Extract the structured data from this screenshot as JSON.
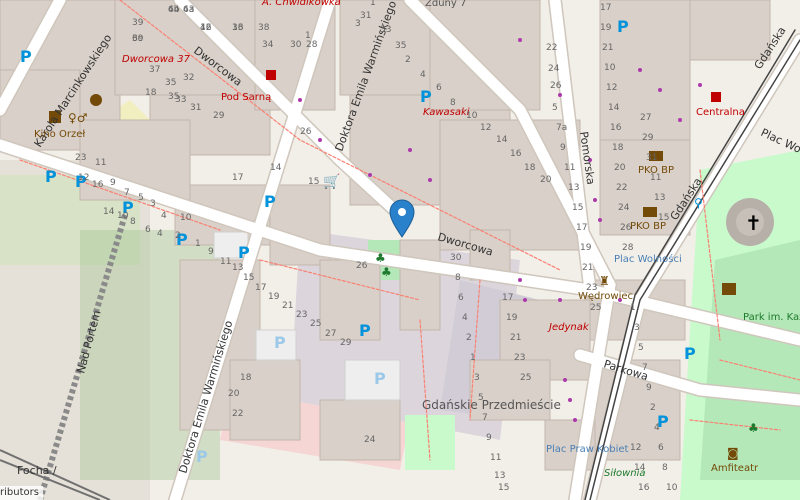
{
  "map": {
    "colors": {
      "background": "#f2efe9",
      "building": "#d9d0c9",
      "building_stroke": "#c4b6ab",
      "road": "#ffffff",
      "road_casing": "#cfc6bc",
      "pedestrian": "#dddde8",
      "park": "#c8facc",
      "green": "#add19e",
      "parking": "#eeeeee",
      "rail": "#707070",
      "footway": "#fa8072",
      "retail": "#ffd6d1",
      "tram": "#444444",
      "parking_icon": "#0092da",
      "label": "#333333",
      "poi_red": "#c00000",
      "poi_brown": "#734a08",
      "marker": "#2a81cb"
    },
    "street_labels": [
      "Karola Marcinkowskiego",
      "Dworcowa",
      "Doktora Emila Warmińskiego",
      "Dworcowa",
      "Nad Portem",
      "Doktora Emila Warmińskiego",
      "Pomorska",
      "Gdańska",
      "Parkowa",
      "Gdańska",
      "Plac Wolności",
      "Focha /"
    ],
    "place_labels": [
      "Gdańskie Przedmieście",
      "Plac Wolności",
      "Park im. Kazimierza Wielkiego",
      "Plac Praw Kobiet"
    ],
    "poi_labels": [
      "Kino Orzeł",
      "Pod Sarną",
      "Centralna",
      "PKO BP",
      "PKO BP",
      "Wędrowiec",
      "Jedynak",
      "Kawasaki",
      "Dworcowa 37",
      "A. Chwidikowka",
      "Siłownia",
      "Amfiteatr",
      "Zduny 7"
    ],
    "house_numbers": [
      "39",
      "44",
      "43",
      "42",
      "36",
      "38",
      "34",
      "30",
      "28",
      "3",
      "1",
      "39",
      "37",
      "35",
      "33",
      "31",
      "29",
      "18",
      "35",
      "32",
      "1",
      "26",
      "17",
      "14",
      "15",
      "23",
      "11",
      "9",
      "7",
      "5",
      "3",
      "4",
      "10",
      "12",
      "16",
      "14",
      "10",
      "8",
      "6",
      "4",
      "2",
      "1",
      "9",
      "11",
      "13",
      "15",
      "17",
      "19",
      "21",
      "23",
      "25",
      "27",
      "29",
      "31",
      "33",
      "35",
      "2",
      "4",
      "6",
      "8",
      "10",
      "12",
      "14",
      "16",
      "18",
      "20",
      "22",
      "24",
      "26",
      "5",
      "7a",
      "9",
      "11",
      "13",
      "15",
      "17",
      "19",
      "21",
      "23",
      "25",
      "27",
      "29",
      "31",
      "11",
      "13",
      "15",
      "17",
      "19",
      "21",
      "10",
      "12",
      "14",
      "16",
      "18",
      "20",
      "22",
      "24",
      "26",
      "28",
      "30",
      "8",
      "6",
      "4",
      "2",
      "1",
      "3",
      "5",
      "7",
      "9",
      "11",
      "13",
      "15",
      "17",
      "19",
      "21",
      "23",
      "25",
      "1",
      "3",
      "5",
      "7",
      "9",
      "2",
      "4",
      "6",
      "8",
      "10",
      "12",
      "14",
      "16",
      "18",
      "20",
      "22",
      "24",
      "26",
      "6c",
      "6b",
      "6a",
      "16",
      "13"
    ],
    "attribution": "ributors"
  }
}
